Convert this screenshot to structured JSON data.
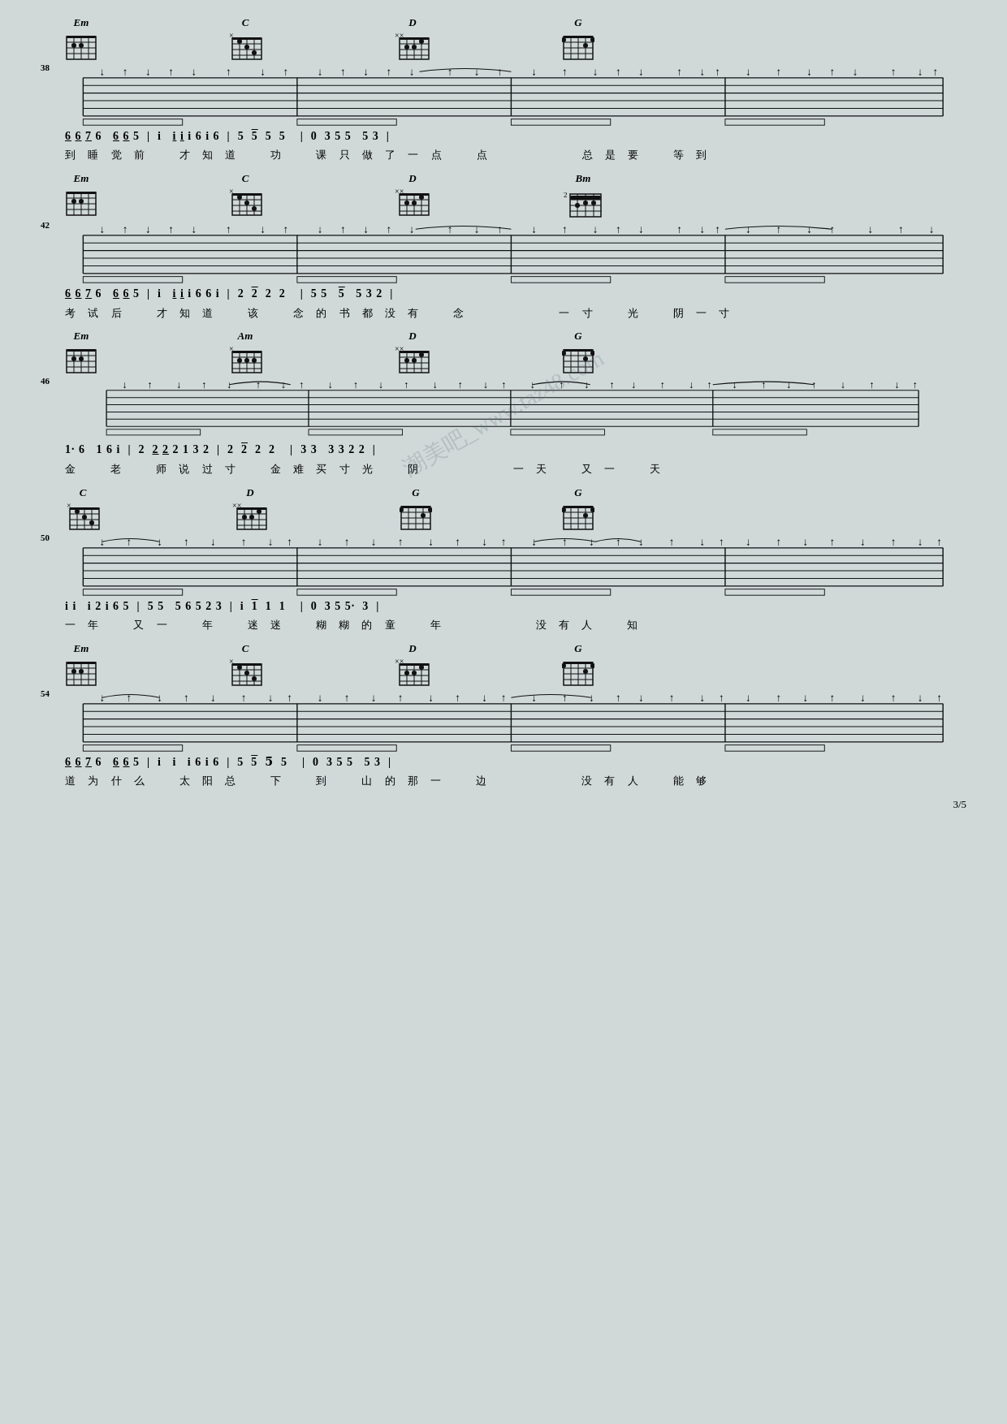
{
  "page": {
    "number": "3/5",
    "background": "#d0d8d8"
  },
  "watermark": "潮美吧_www.taz48.com",
  "sections": [
    {
      "id": "sec38",
      "number": "38",
      "chords": [
        {
          "name": "Em",
          "position": 0,
          "xmarks": "",
          "fret": null
        },
        {
          "name": "C",
          "position": 230,
          "xmarks": "×",
          "fret": null
        },
        {
          "name": "D",
          "position": 460,
          "xmarks": "××",
          "fret": null
        },
        {
          "name": "G",
          "position": 730,
          "xmarks": "",
          "fret": null
        }
      ],
      "notation": "6 6 7 6   6 6 5 | i   i i i 6 i 6 | 5  5̄  5  5   | 0  3 5 5   5 3 |",
      "lyrics": "到 睡 觉 前   才 知 道   功   课 只 做 了 一 点   点               总 是 要   等 到"
    },
    {
      "id": "sec42",
      "number": "42",
      "chords": [
        {
          "name": "Em",
          "position": 0,
          "xmarks": "",
          "fret": null
        },
        {
          "name": "C",
          "position": 230,
          "xmarks": "×",
          "fret": null
        },
        {
          "name": "D",
          "position": 460,
          "xmarks": "××",
          "fret": null
        },
        {
          "name": "Bm",
          "position": 730,
          "xmarks": "",
          "fret": "2"
        }
      ],
      "notation": "6 6 7 6   6 6 5 | i   i i i 6 6 i | 2  2̄  2  2   | 5 5   5̄   5 3 2 |",
      "lyrics": "考 试 后   才 知 道   该   念 的 书 都 没 有   念               一 寸   光   阴 一 寸"
    },
    {
      "id": "sec46",
      "number": "46",
      "chords": [
        {
          "name": "Em",
          "position": 0,
          "xmarks": "",
          "fret": null
        },
        {
          "name": "Am",
          "position": 230,
          "xmarks": "×",
          "fret": null
        },
        {
          "name": "D",
          "position": 460,
          "xmarks": "××",
          "fret": null
        },
        {
          "name": "G",
          "position": 730,
          "xmarks": "",
          "fret": null
        }
      ],
      "notation": "1·  6   1 6 i | 2  2 2 2 1 3 2 | 2  2̄  2  2   | 3 3   3 3 2 2 |",
      "lyrics": "金   老   师 说 过 寸   金 难 买 寸 光   阴               一 天   又 一   天"
    },
    {
      "id": "sec50",
      "number": "50",
      "chords": [
        {
          "name": "C",
          "position": 0,
          "xmarks": "×",
          "fret": null
        },
        {
          "name": "D",
          "position": 230,
          "xmarks": "××",
          "fret": null
        },
        {
          "name": "G",
          "position": 460,
          "xmarks": "",
          "fret": null
        },
        {
          "name": "G",
          "position": 730,
          "xmarks": "",
          "fret": null
        }
      ],
      "notation": "i i   i 2 i 6 5 | 5 5   5 6 5 2 3 | i  1̄  1  1   | 0  3 5 5·  3 |",
      "lyrics": "一 年   又 一   年   迷 迷   糊 糊 的 童   年               没 有 人   知"
    },
    {
      "id": "sec54",
      "number": "54",
      "chords": [
        {
          "name": "Em",
          "position": 0,
          "xmarks": "",
          "fret": null
        },
        {
          "name": "C",
          "position": 230,
          "xmarks": "×",
          "fret": null
        },
        {
          "name": "D",
          "position": 460,
          "xmarks": "××",
          "fret": null
        },
        {
          "name": "G",
          "position": 730,
          "xmarks": "",
          "fret": null
        }
      ],
      "notation": "6 6 7 6   6 6 5 | i   i   i 6 i 6 | 5  5̄  5  5   | 0  3 5 5   5 3 |",
      "lyrics": "道 为 什 么   太 阳 总   下   到   山 的 那 一   边               没 有 人   能 够"
    }
  ]
}
